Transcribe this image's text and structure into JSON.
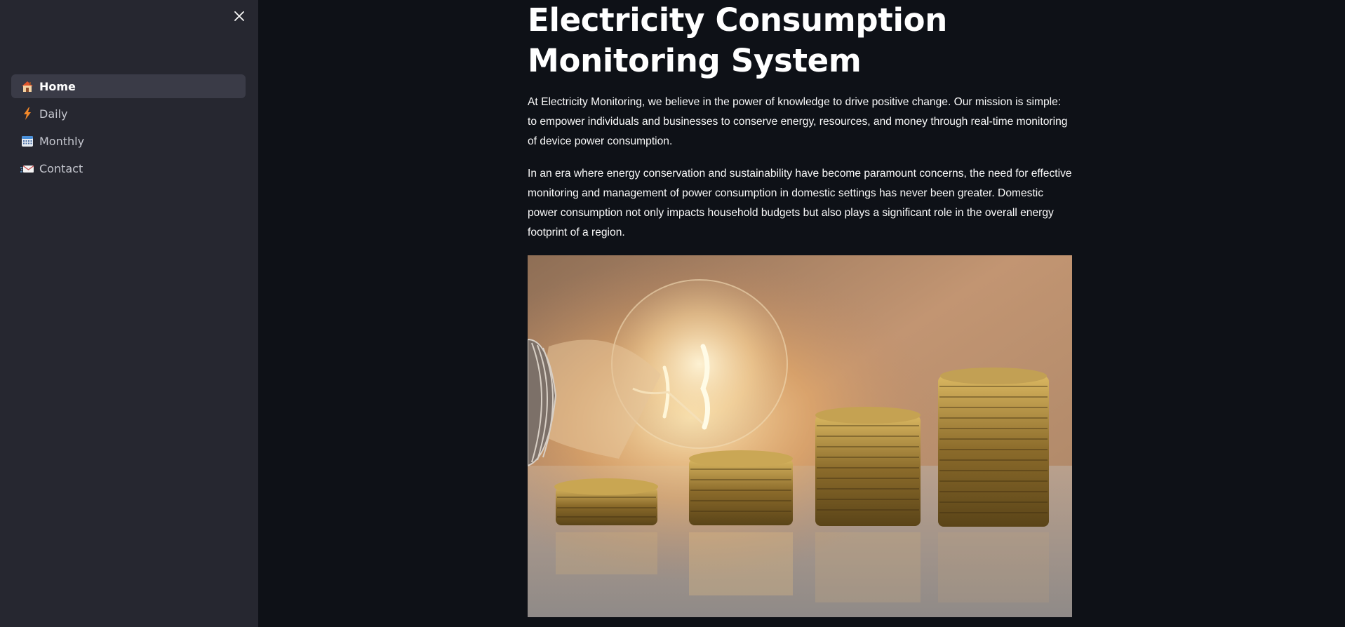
{
  "sidebar": {
    "close_icon": "close-icon",
    "items": [
      {
        "label": "Home",
        "icon": "house-icon",
        "active": true
      },
      {
        "label": "Daily",
        "icon": "lightning-icon",
        "active": false
      },
      {
        "label": "Monthly",
        "icon": "calendar-icon",
        "active": false
      },
      {
        "label": "Contact",
        "icon": "envelope-icon",
        "active": false
      }
    ]
  },
  "main": {
    "title": "Electricity Consumption Monitoring System",
    "paragraph1": "At Electricity Monitoring, we believe in the power of knowledge to drive positive change. Our mission is simple: to empower individuals and businesses to conserve energy, resources, and money through real-time monitoring of device power consumption.",
    "paragraph2": "In an era where energy conservation and sustainability have become paramount concerns, the need for effective monitoring and management of power consumption in domestic settings has never been greater. Domestic power consumption not only impacts household budgets but also plays a significant role in the overall energy footprint of a region."
  },
  "colors": {
    "background": "#0e1117",
    "sidebar": "#262730",
    "active_item": "#3a3b47",
    "text": "#fafafa"
  }
}
